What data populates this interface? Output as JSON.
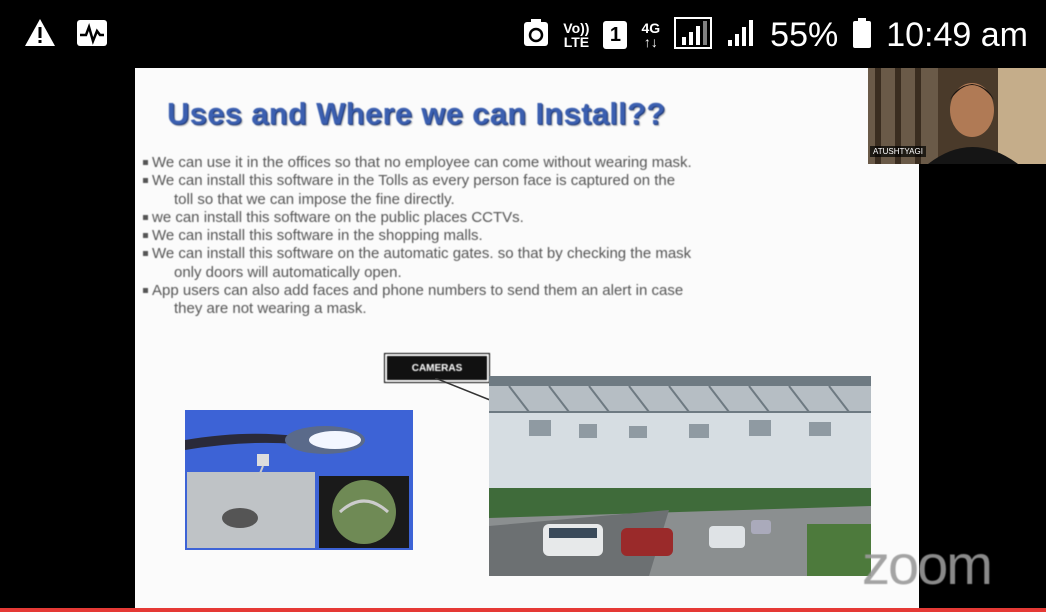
{
  "status_bar": {
    "left_icons": [
      "warning-icon",
      "activity-icon"
    ],
    "right_icons": [
      "recycle-icon"
    ],
    "volte_top": "Vo))",
    "volte_bottom": "LTE",
    "sim_number": "1",
    "network_type": "4G",
    "network_arrows": "↑↓",
    "battery_percent": "55%",
    "time": "10:49 am"
  },
  "slide": {
    "title": "Uses and Where we can Install??",
    "bullets": [
      {
        "text": "We can use it in the offices so that no employee can come without wearing mask.",
        "cont": ""
      },
      {
        "text": "We can install this software in the Tolls as every person face is captured on the",
        "cont": "toll so that we can impose the fine directly."
      },
      {
        "text": "we can install this software on the public places CCTVs.",
        "cont": ""
      },
      {
        "text": "We can install this software in the shopping malls.",
        "cont": ""
      },
      {
        "text": "We can install this software on the automatic gates. so that by checking the mask",
        "cont": "only doors will automatically open."
      },
      {
        "text": "App users can also add faces and phone numbers to send them an alert in case",
        "cont": "they are not wearing a mask."
      }
    ],
    "cameras_label": "CAMERAS"
  },
  "meeting": {
    "app_logo": "zoom",
    "participant_name": "ATUSHTYAGI"
  }
}
